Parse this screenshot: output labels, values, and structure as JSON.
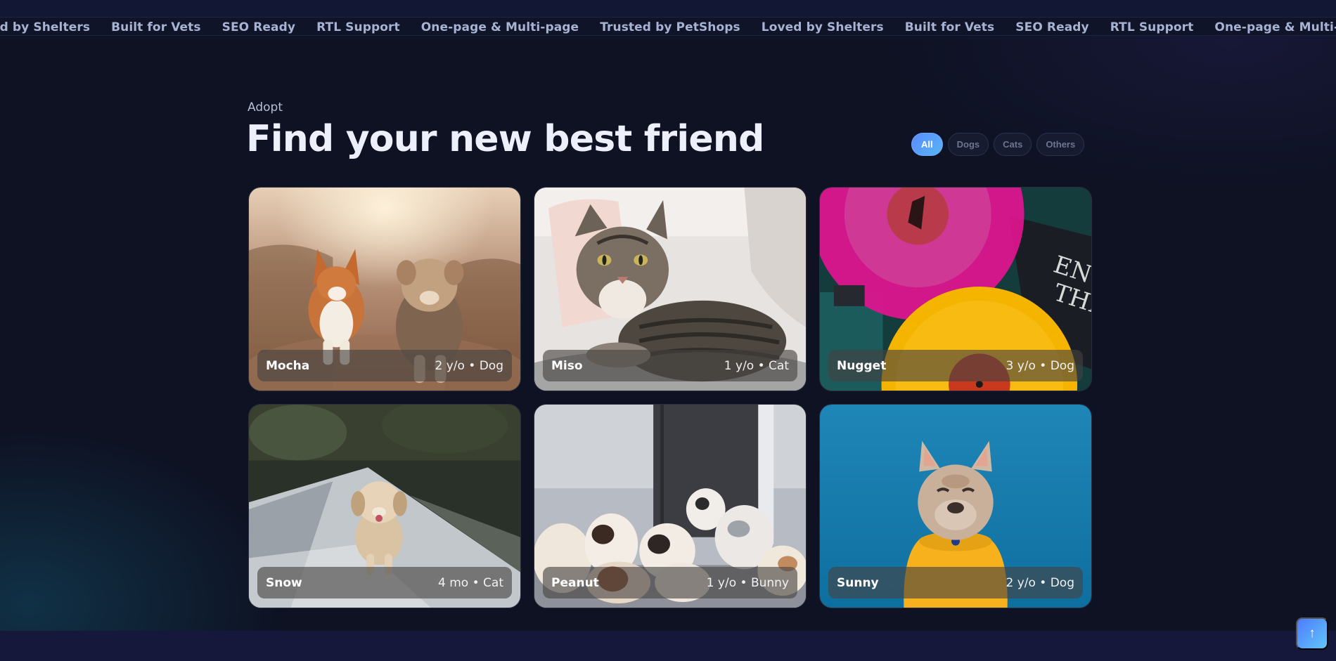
{
  "marquee": {
    "items": [
      "ed by Shelters",
      "Built for Vets",
      "SEO Ready",
      "RTL Support",
      "One-page & Multi-page",
      "Trusted by PetShops",
      "Loved by Shelters",
      "Built for Vets",
      "SEO Ready",
      "RTL Support",
      "One-page & Multi-page"
    ]
  },
  "section": {
    "eyebrow": "Adopt",
    "title": "Find your new best friend"
  },
  "filters": {
    "options": [
      "All",
      "Dogs",
      "Cats",
      "Others"
    ],
    "selected": "All"
  },
  "pets": [
    {
      "name": "Mocha",
      "meta": "2 y/o • Dog",
      "photo": "corgi-and-terrier-photo"
    },
    {
      "name": "Miso",
      "meta": "1 y/o • Cat",
      "photo": "tabby-cat-photo"
    },
    {
      "name": "Nugget",
      "meta": "3 y/o • Dog",
      "photo": "vinyl-records-photo"
    },
    {
      "name": "Snow",
      "meta": "4 mo • Cat",
      "photo": "running-puppy-photo"
    },
    {
      "name": "Peanut",
      "meta": "1 y/o • Bunny",
      "photo": "puppy-litter-photo"
    },
    {
      "name": "Sunny",
      "meta": "2 y/o • Dog",
      "photo": "french-bulldog-photo"
    }
  ],
  "back_to_top": {
    "label": "↑"
  },
  "colors": {
    "background": "#0e1223",
    "accent_start": "#5a8bff",
    "accent_end": "#58b6f3"
  }
}
